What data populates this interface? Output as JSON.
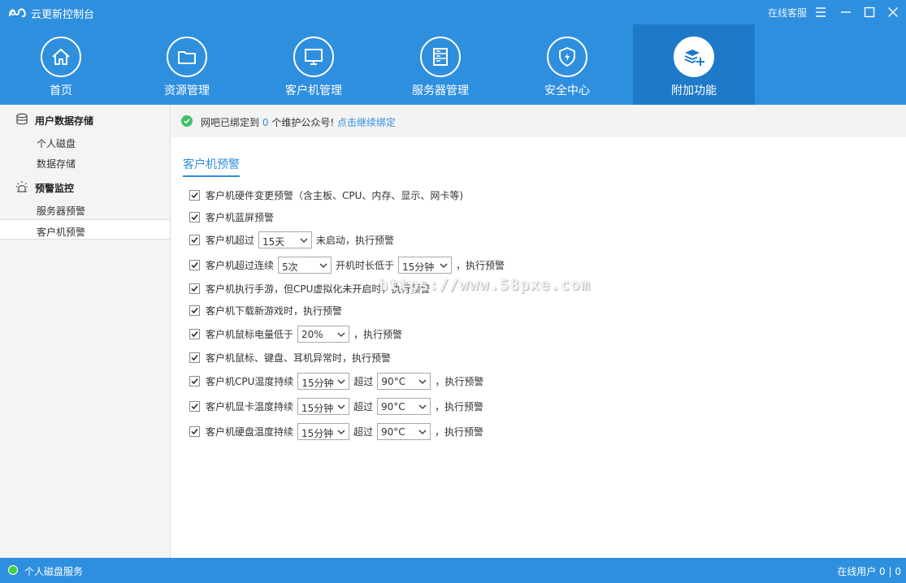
{
  "app": {
    "title": "云更新控制台",
    "service_link": "在线客服"
  },
  "colors": {
    "primary": "#2f8fdf",
    "active_nav": "#1f79c9",
    "ok_green": "#3cc06a",
    "status_green": "#41d244"
  },
  "nav": {
    "items": [
      {
        "label": "首页",
        "icon": "home-icon"
      },
      {
        "label": "资源管理",
        "icon": "folder-icon"
      },
      {
        "label": "客户机管理",
        "icon": "monitor-icon"
      },
      {
        "label": "服务器管理",
        "icon": "server-icon"
      },
      {
        "label": "安全中心",
        "icon": "shield-icon"
      },
      {
        "label": "附加功能",
        "icon": "layers-plus-icon",
        "active": true
      }
    ]
  },
  "sidebar": {
    "groups": [
      {
        "label": "用户数据存储",
        "icon": "database-icon",
        "items": [
          "个人磁盘",
          "数据存储"
        ]
      },
      {
        "label": "预警监控",
        "icon": "alarm-icon",
        "items": [
          "服务器预警",
          "客户机预警"
        ]
      }
    ],
    "active_item": "客户机预警"
  },
  "notice": {
    "prefix": "网吧已绑定到",
    "count": "0",
    "suffix": "个维护公众号!",
    "link": "点击继续绑定"
  },
  "section": {
    "title": "客户机预警"
  },
  "options": {
    "o1": {
      "text": "客户机硬件变更预警（含主板、CPU、内存、显示、网卡等)"
    },
    "o2": {
      "text": "客户机蓝屏预警"
    },
    "o3": {
      "pre": "客户机超过",
      "sel": "15天",
      "post": "未启动，执行预警"
    },
    "o4": {
      "pre": "客户机超过连续",
      "sel1": "5次",
      "mid": "开机时长低于",
      "sel2": "15分钟",
      "post": "，执行预警"
    },
    "o5": {
      "text": "客户机执行手游，但CPU虚拟化未开启时，执行预警"
    },
    "o6": {
      "text": "客户机下载新游戏时，执行预警"
    },
    "o7": {
      "pre": "客户机鼠标电量低于",
      "sel": "20%",
      "post": "，执行预警"
    },
    "o8": {
      "text": "客户机鼠标、键盘、耳机异常时，执行预警"
    },
    "o9": {
      "pre": "客户机CPU温度持续",
      "sel1": "15分钟",
      "mid": "超过",
      "sel2": "90°C",
      "post": "，执行预警"
    },
    "o10": {
      "pre": "客户机显卡温度持续",
      "sel1": "15分钟",
      "mid": "超过",
      "sel2": "90°C",
      "post": "，执行预警"
    },
    "o11": {
      "pre": "客户机硬盘温度持续",
      "sel1": "15分钟",
      "mid": "超过",
      "sel2": "90°C",
      "post": "，执行预警"
    }
  },
  "watermark": "https://www.58pxe.com",
  "status": {
    "left": "个人磁盘服务",
    "right": "在线用户  0 | 0"
  }
}
